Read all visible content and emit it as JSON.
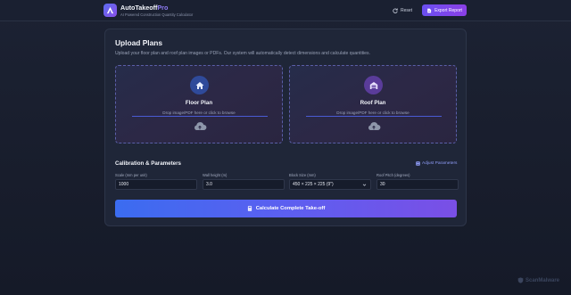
{
  "header": {
    "brand_main": "AutoTakeoff",
    "brand_accent": "Pro",
    "subtitle": "AI Powered Construction Quantity Calculator",
    "reset_label": "Reset",
    "export_label": "Export Report"
  },
  "upload": {
    "title": "Upload Plans",
    "description": "Upload your floor plan and roof plan images or PDFs. Our system will automatically detect dimensions and calculate quantities.",
    "floor": {
      "title": "Floor Plan",
      "hint": "Drop image/PDF here or click to browse",
      "icon": "home-icon"
    },
    "roof": {
      "title": "Roof Plan",
      "hint": "Drop image/PDF here or click to browse",
      "icon": "garage-icon"
    }
  },
  "calibration": {
    "title": "Calibration & Parameters",
    "adjust_label": "Adjust Parameters",
    "fields": [
      {
        "label": "Scale (mm per unit)",
        "value": "1000"
      },
      {
        "label": "Wall height (m)",
        "value": "3.0"
      },
      {
        "label": "Block Size (mm)",
        "value": "450 × 225 × 225 (9\")"
      },
      {
        "label": "Roof Pitch (degrees)",
        "value": "30"
      }
    ]
  },
  "calculate_label": "Calculate Complete Take-off",
  "watermark": "ScanMalware",
  "colors": {
    "background": "#181d2c",
    "card": "#1f2638",
    "accent_blue": "#3b6cf0",
    "accent_purple": "#7a4fe6"
  }
}
